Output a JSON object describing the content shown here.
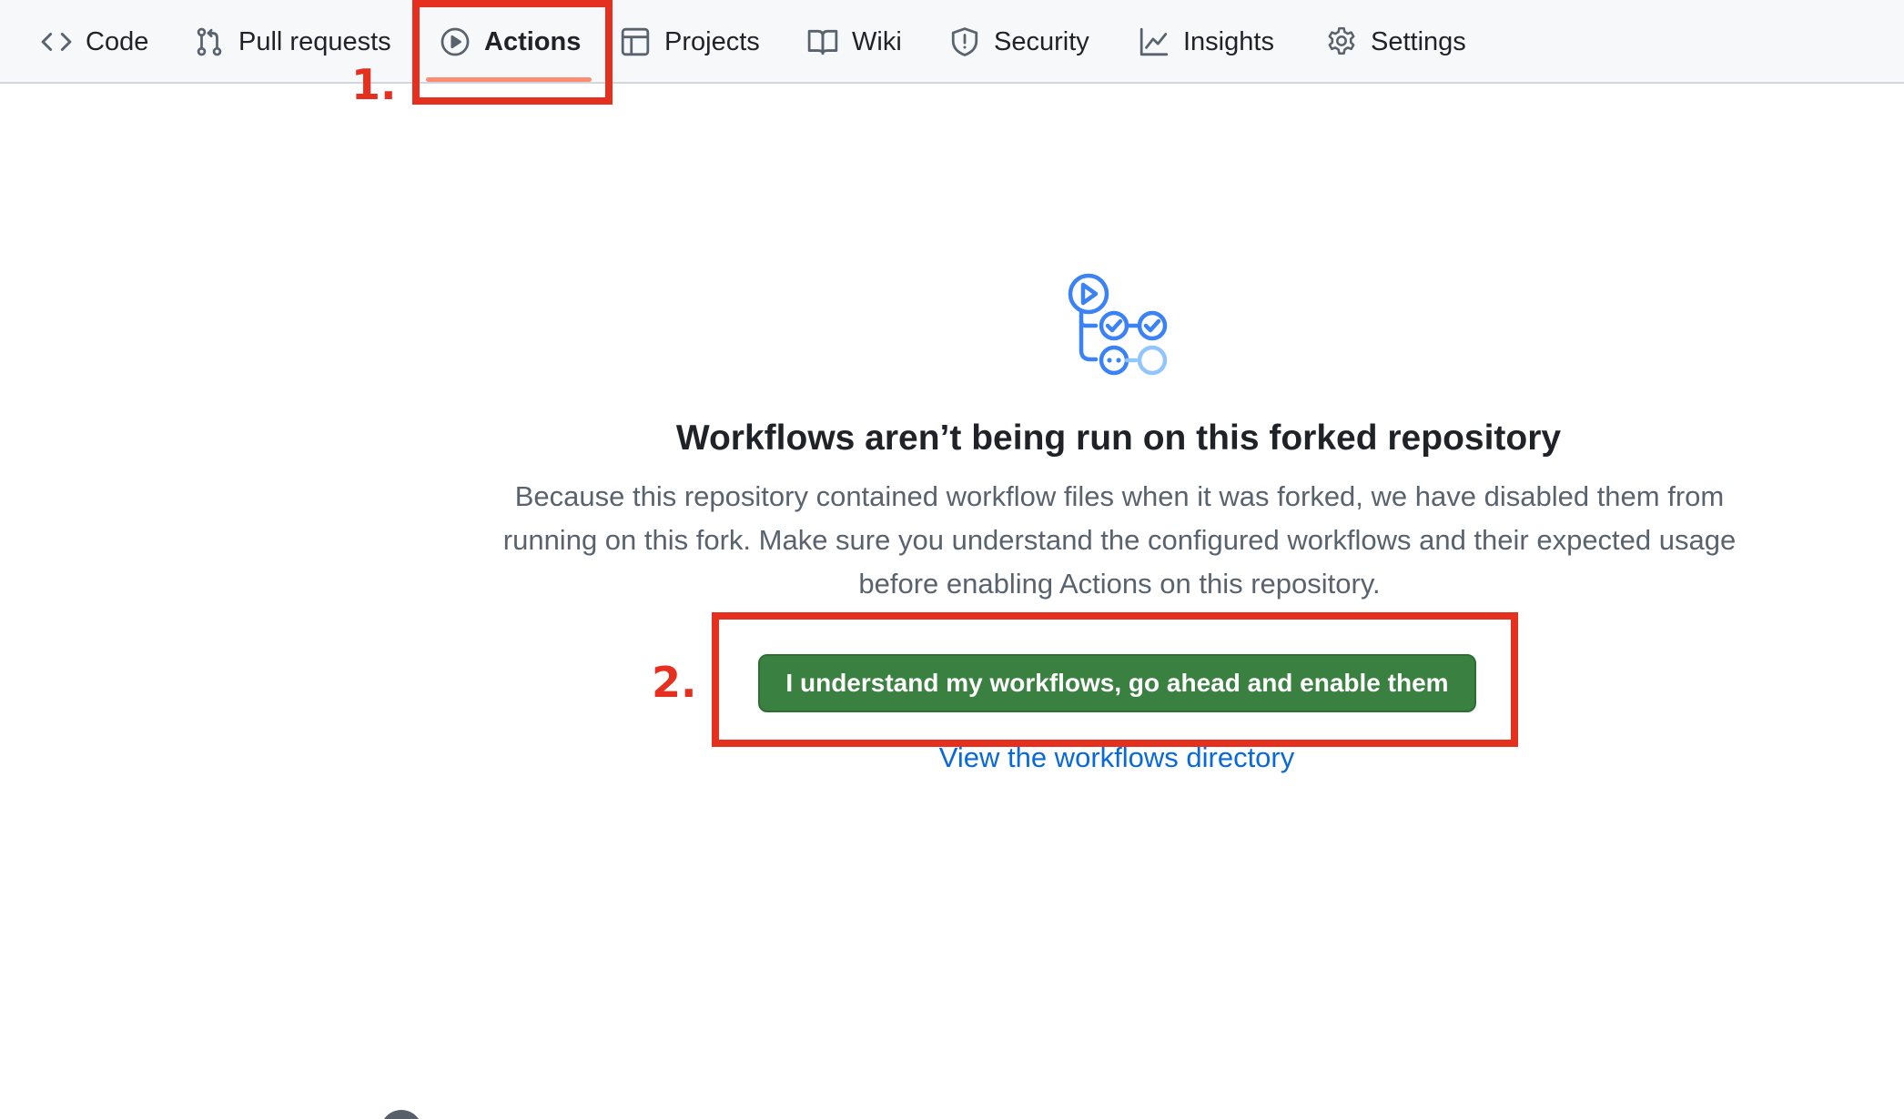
{
  "nav": {
    "tabs": [
      {
        "label": "Code",
        "icon": "code-icon"
      },
      {
        "label": "Pull requests",
        "icon": "pull-request-icon"
      },
      {
        "label": "Actions",
        "icon": "play-icon",
        "active": true
      },
      {
        "label": "Projects",
        "icon": "table-icon"
      },
      {
        "label": "Wiki",
        "icon": "book-icon"
      },
      {
        "label": "Security",
        "icon": "shield-icon"
      },
      {
        "label": "Insights",
        "icon": "graph-icon"
      },
      {
        "label": "Settings",
        "icon": "gear-icon"
      }
    ]
  },
  "annotations": {
    "step1": "1.",
    "step2": "2.",
    "color": "#e5301f"
  },
  "main": {
    "icon": "workflow-icon",
    "title": "Workflows aren’t being run on this forked repository",
    "description": "Because this repository contained workflow files when it was forked, we have disabled them from running on this fork. Make sure you understand the configured workflows and their expected usage before enabling Actions on this repository.",
    "enable_button": "I understand my workflows, go ahead and enable them",
    "directory_link": "View the workflows directory"
  },
  "colors": {
    "button_green": "#3a8141",
    "link_blue": "#0969da",
    "active_underline": "#fd8c73"
  }
}
